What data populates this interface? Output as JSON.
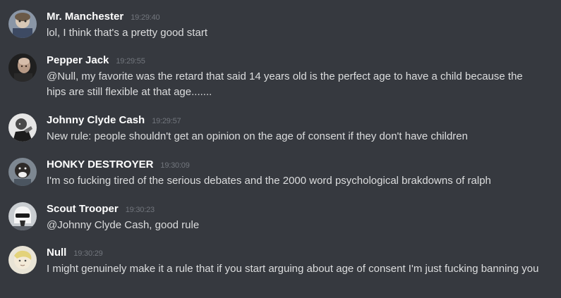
{
  "messages": [
    {
      "username": "Mr. Manchester",
      "timestamp": "19:29:40",
      "text": "lol, I think that's a pretty good start",
      "avatar": "avatar-mr-manchester"
    },
    {
      "username": "Pepper Jack",
      "timestamp": "19:29:55",
      "text": "@Null, my favorite was the retard that said 14 years old is the perfect age to have a child because the hips are still flexible at that age.......",
      "avatar": "avatar-pepper-jack"
    },
    {
      "username": "Johnny Clyde Cash",
      "timestamp": "19:29:57",
      "text": "New rule: people shouldn't get an opinion on the age of consent if they don't have children",
      "avatar": "avatar-johnny-clyde-cash"
    },
    {
      "username": "HONKY DESTROYER",
      "timestamp": "19:30:09",
      "text": "I'm so fucking tired of the serious debates and the 2000 word psychological brakdowns of ralph",
      "avatar": "avatar-honky-destroyer"
    },
    {
      "username": "Scout Trooper",
      "timestamp": "19:30:23",
      "text": "@Johnny Clyde Cash, good rule",
      "avatar": "avatar-scout-trooper"
    },
    {
      "username": "Null",
      "timestamp": "19:30:29",
      "text": "I might genuinely make it a rule that if you start arguing about age of consent I'm just fucking banning you",
      "avatar": "avatar-null"
    }
  ],
  "colors": {
    "background": "#36393f",
    "username": "#ffffff",
    "timestamp": "#72767d",
    "text": "#dcddde"
  }
}
